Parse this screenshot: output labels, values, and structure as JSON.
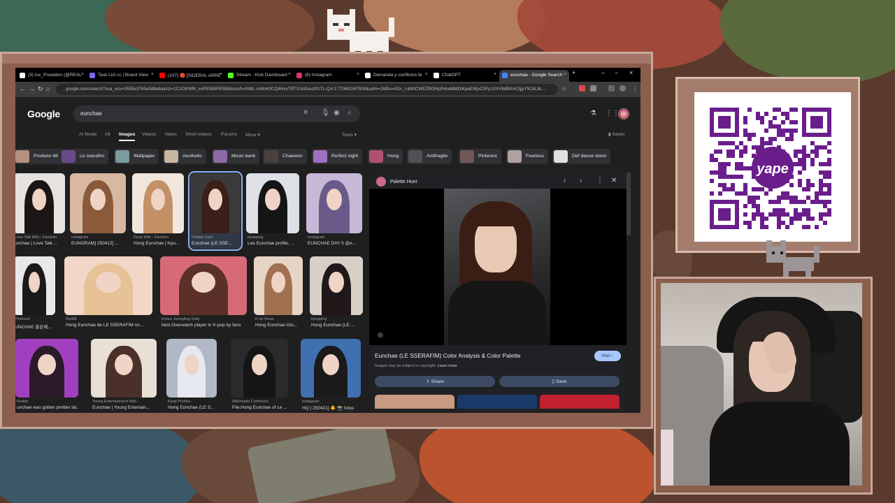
{
  "browser": {
    "tabs": [
      {
        "label": "(3) Ice_Poseidon (@REAL",
        "favicon_color": "#ffffff"
      },
      {
        "label": "Task List cc | Board View",
        "favicon_color": "#7b68ee"
      },
      {
        "label": "(107) 🔴 [SIDERAL ARRE",
        "favicon_color": "#ff0000"
      },
      {
        "label": "Stream - Kick Dashboard",
        "favicon_color": "#53fc18"
      },
      {
        "label": "(8) Instagram",
        "favicon_color": "#e1306c"
      },
      {
        "label": "Demanda y conflictos fe",
        "favicon_color": "#ffffff"
      },
      {
        "label": "ChatGPT",
        "favicon_color": "#ffffff"
      },
      {
        "label": "eunchae - Google Search",
        "favicon_color": "#4285f4"
      }
    ],
    "new_tab_icon": "plus-icon",
    "url": "google.com/search?sca_esv=0555e3765a0d8a6a&rlz=1C1OKWM_esPE958PE958&sxsrf=ANbL-n4doh0CQ4HvxTilfT1GoDeuzPcTL-QA:1772681547926&udm=2&fbs=ADc_l-aN0CWEZBOHjofHoaMMDiKpaEWjvZ2Py1XXV8dBKvK3jjyY5CkLbL...",
    "back_icon": "back-arrow-icon",
    "forward_icon": "forward-arrow-icon",
    "reload_icon": "reload-icon",
    "home_icon": "home-icon"
  },
  "google": {
    "logo": "Google",
    "query": "eunchae",
    "filters": [
      "AI Mode",
      "All",
      "Images",
      "Videos",
      "News",
      "Short videos",
      "Forums",
      "More"
    ],
    "active_filter": "Images",
    "tools": "Tools",
    "saves": "Saves",
    "chips": [
      {
        "label": "Produce 48",
        "color": "#b78f7f"
      },
      {
        "label": "Le sserafim",
        "color": "#6a4a8a"
      },
      {
        "label": "Wallpaper",
        "color": "#7c9aa0"
      },
      {
        "label": "Aesthetic",
        "color": "#c9b6a2"
      },
      {
        "label": "Music bank",
        "color": "#8c6aa8"
      },
      {
        "label": "Chaewon",
        "color": "#4a4040"
      },
      {
        "label": "Perfect night",
        "color": "#a070c0"
      },
      {
        "label": "Hong",
        "color": "#b05070"
      },
      {
        "label": "Antifragile",
        "color": "#505058"
      },
      {
        "label": "Pinterest",
        "color": "#705858"
      },
      {
        "label": "Fearless",
        "color": "#b0a0a0"
      },
      {
        "label": "Def dance skool",
        "color": "#e0e0e0"
      }
    ],
    "results": [
      {
        "source": "Love Talk Wiki - Fandom",
        "title": "unchae | Love Talk ...",
        "bg": "#e6e2de",
        "hair": "#1b1515"
      },
      {
        "source": "Instagram",
        "title": "EUNGRAM] 250412] ...",
        "bg": "#d8b8a0",
        "hair": "#8a5a3a"
      },
      {
        "source": "Kpop Wiki - Fandom",
        "title": "Hong Eunchae | Kpo...",
        "bg": "#f0e6dc",
        "hair": "#c49066"
      },
      {
        "source": "Palette Hunt",
        "title": "Eunchae (LE SSE...",
        "bg": "#3a3a3c",
        "hair": "#3a2018"
      },
      {
        "source": "kpopping",
        "title": "Lee Eunchae profile, ...",
        "bg": "#dde0e6",
        "hair": "#151515"
      },
      {
        "source": "Instagram",
        "title": "EUNCHAE DAY 5 @e...",
        "bg": "#c8b8d8",
        "hair": "#6a5a8a"
      },
      {
        "source": "Pinterest",
        "title": "UNCHAE 홍은채...",
        "bg": "#e8e8ea",
        "hair": "#1a1a1a"
      },
      {
        "source": "Reddit",
        "title": "Hong Eunchae de LE SSERAFIM no ...",
        "bg": "#f2d6c8",
        "hair": "#e6c296"
      },
      {
        "source": "Korea JoongAng Daily",
        "title": "best Overwatch player in K-pop by fans",
        "bg": "#d86a78",
        "hair": "#5a3028"
      },
      {
        "source": "K-en News",
        "title": "Hong Eunchae Gio...",
        "bg": "#e6d4c4",
        "hair": "#a07050"
      },
      {
        "source": "kpopping",
        "title": "Hong Eunchae (LE ...",
        "bg": "#d8d0c8",
        "hair": "#201818"
      },
      {
        "source": "Reddit",
        "title": "unchae was gotten prettier lat...",
        "bg": "#a040c0",
        "hair": "#2a1a2a"
      },
      {
        "source": "Young Entertainment Wiki -",
        "title": "Eunchae | Young Entertain...",
        "bg": "#e8e0d4",
        "hair": "#4a3028"
      },
      {
        "source": "Kpop Profiles",
        "title": "Hong Eunchae (LE S...",
        "bg": "#b0b8c8",
        "hair": "#e8e8f0"
      },
      {
        "source": "Wikimedia Commons",
        "title": "File:Hong Eunchae of Le ...",
        "bg": "#2a2a2c",
        "hair": "#151515"
      },
      {
        "source": "Instagram",
        "title": "HQ | 250421] 🐥 📸 fotos",
        "bg": "#4070b0",
        "hair": "#1a1a1a"
      }
    ],
    "preview": {
      "site": "Palette Hunt",
      "caption": "Eunchae (LE SSERAFIM) Color Analysis & Color Palette",
      "copyright": "Images may be subject to copyright.",
      "learn_more": "Learn more",
      "visit": "Visit",
      "share": "Share",
      "save": "Save",
      "related_colors": [
        "#c89a80",
        "#1a3a6a",
        "#c02030"
      ]
    }
  },
  "overlay": {
    "qr_brand": "yape",
    "qr_color": "#6a1e8c"
  }
}
